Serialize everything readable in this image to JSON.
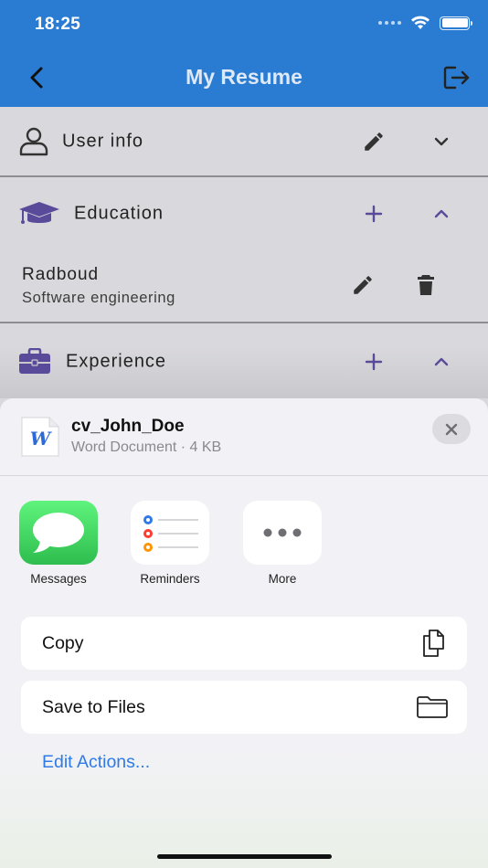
{
  "status_bar": {
    "time": "18:25"
  },
  "nav": {
    "title": "My Resume",
    "back_icon": "chevron-left-icon",
    "logout_icon": "logout-icon"
  },
  "sections": {
    "user_info": {
      "label": "User info"
    },
    "education": {
      "label": "Education"
    },
    "experience": {
      "label": "Experience"
    }
  },
  "education_entry": {
    "title": "Radboud",
    "subtitle": "Software engineering"
  },
  "share_sheet": {
    "file": {
      "name": "cv_John_Doe",
      "meta": "Word Document · 4 KB",
      "icon_letter": "W"
    },
    "apps": [
      {
        "label": "Messages"
      },
      {
        "label": "Reminders"
      },
      {
        "label": "More"
      }
    ],
    "actions": [
      {
        "label": "Copy"
      },
      {
        "label": "Save to Files"
      }
    ],
    "edit_actions_label": "Edit Actions..."
  },
  "colors": {
    "nav_blue": "#2a7cd2",
    "accent_purple": "#5a4b9a",
    "link_blue": "#2f7ae6",
    "messages_green": "#35c759"
  }
}
